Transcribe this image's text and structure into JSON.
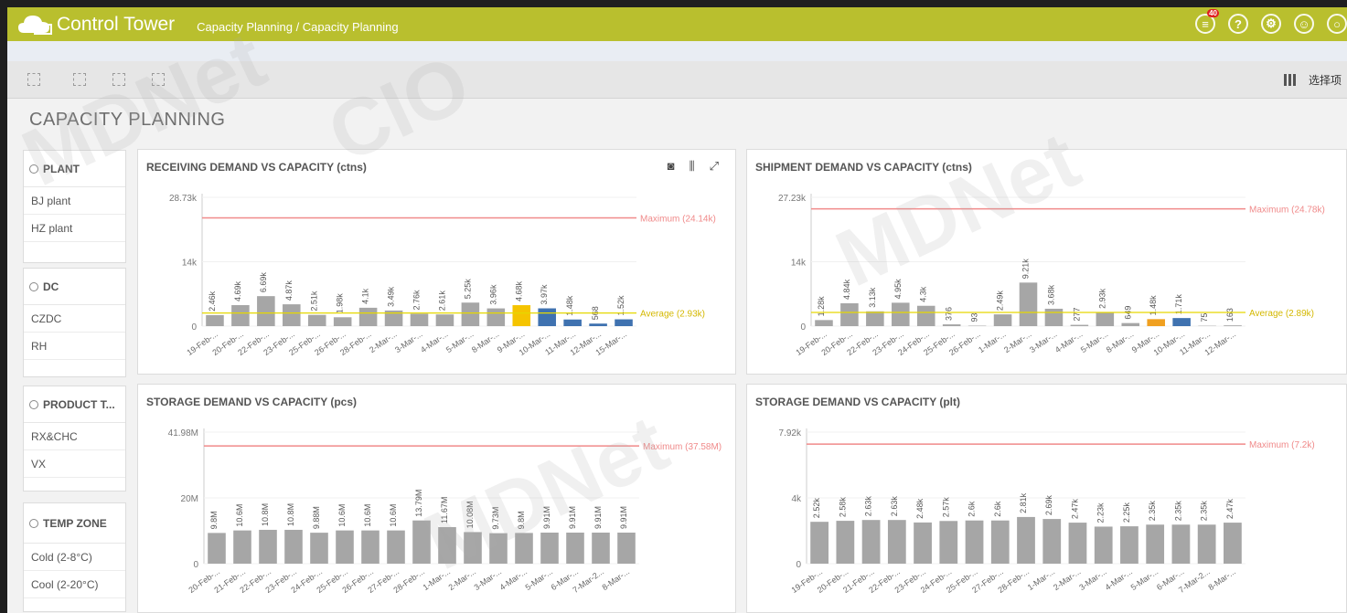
{
  "header": {
    "app_title": "Control Tower",
    "breadcrumb": "Capacity Planning / Capacity Planning",
    "notification_count": "40"
  },
  "toolbar": {
    "selections_label": "选择项"
  },
  "sheet": {
    "title": "CAPACITY PLANNING"
  },
  "filters": [
    {
      "title": "PLANT",
      "items": [
        "BJ plant",
        "HZ plant"
      ]
    },
    {
      "title": "DC",
      "items": [
        "CZDC",
        "RH"
      ]
    },
    {
      "title": "PRODUCT T...",
      "items": [
        "RX&CHC",
        "VX"
      ]
    },
    {
      "title": "TEMP ZONE",
      "items": [
        "Cold (2-8°C)",
        "Cool (2-20°C)"
      ]
    }
  ],
  "colors": {
    "accent": "#b9bf2e",
    "bar": "#a6a6a6",
    "max_line": "#f08a8a",
    "avg_line": "#e6d800",
    "yellow": "#f5c400",
    "blue": "#3f72b0",
    "orange": "#f0a020"
  },
  "chart_data": [
    {
      "type": "bar",
      "title": "RECEIVING DEMAND VS CAPACITY (ctns)",
      "categories": [
        "19-Feb-...",
        "20-Feb-...",
        "22-Feb-...",
        "23-Feb-...",
        "25-Feb-...",
        "26-Feb-...",
        "28-Feb-...",
        "2-Mar-...",
        "3-Mar-...",
        "4-Mar-...",
        "5-Mar-...",
        "8-Mar-...",
        "9-Mar-...",
        "10-Mar-...",
        "11-Mar-...",
        "12-Mar-...",
        "15-Mar-..."
      ],
      "values": [
        2460,
        4690,
        6690,
        4870,
        2510,
        1980,
        4100,
        3490,
        2760,
        2610,
        5250,
        3960,
        4680,
        3970,
        1480,
        568,
        1520
      ],
      "value_labels": [
        "2.46k",
        "4.69k",
        "6.69k",
        "4.87k",
        "2.51k",
        "1.98k",
        "4.1k",
        "3.49k",
        "2.76k",
        "2.61k",
        "5.25k",
        "3.96k",
        "4.68k",
        "3.97k",
        "1.48k",
        "568",
        "1.52k"
      ],
      "bar_colors": [
        "bar",
        "bar",
        "bar",
        "bar",
        "bar",
        "bar",
        "bar",
        "bar",
        "bar",
        "bar",
        "bar",
        "bar",
        "yellow",
        "blue",
        "blue",
        "blue",
        "blue"
      ],
      "y_ticks": [
        "28.73k",
        "14k",
        "0"
      ],
      "ylim": [
        0,
        28730
      ],
      "max_value": 24140,
      "max_label": "Maximum (24.14k)",
      "avg_value": 2930,
      "avg_label": "Average (2.93k)"
    },
    {
      "type": "bar",
      "title": "SHIPMENT DEMAND VS CAPACITY (ctns)",
      "categories": [
        "19-Feb-...",
        "20-Feb-...",
        "22-Feb-...",
        "23-Feb-...",
        "24-Feb-...",
        "25-Feb-...",
        "26-Feb-...",
        "1-Mar-...",
        "2-Mar-...",
        "3-Mar-...",
        "4-Mar-...",
        "5-Mar-...",
        "8-Mar-...",
        "9-Mar-...",
        "10-Mar-...",
        "11-Mar-...",
        "12-Mar-..."
      ],
      "values": [
        1280,
        4840,
        3130,
        4950,
        4300,
        376,
        93,
        2490,
        9210,
        3680,
        277,
        2930,
        649,
        1480,
        1710,
        75,
        163
      ],
      "value_labels": [
        "1.28k",
        "4.84k",
        "3.13k",
        "4.95k",
        "4.3k",
        "376",
        "93",
        "2.49k",
        "9.21k",
        "3.68k",
        "277",
        "2.93k",
        "649",
        "1.48k",
        "1.71k",
        "75",
        "163"
      ],
      "bar_colors": [
        "bar",
        "bar",
        "bar",
        "bar",
        "bar",
        "bar",
        "bar",
        "bar",
        "bar",
        "bar",
        "bar",
        "bar",
        "bar",
        "orange",
        "blue",
        "bar",
        "bar"
      ],
      "y_ticks": [
        "27.23k",
        "14k",
        "0"
      ],
      "ylim": [
        0,
        27230
      ],
      "max_value": 24780,
      "max_label": "Maximum (24.78k)",
      "avg_value": 2890,
      "avg_label": "Average (2.89k)"
    },
    {
      "type": "bar",
      "title": "STORAGE DEMAND VS CAPACITY (pcs)",
      "categories": [
        "20-Feb-...",
        "21-Feb-...",
        "22-Feb-...",
        "23-Feb-...",
        "24-Feb-...",
        "25-Feb-...",
        "26-Feb-...",
        "27-Feb-...",
        "28-Feb-...",
        "1-Mar-...",
        "2-Mar-...",
        "3-Mar-...",
        "4-Mar-...",
        "5-Mar-...",
        "6-Mar-...",
        "7-Mar-2...",
        "8-Mar-..."
      ],
      "values": [
        9800000,
        10600000,
        10800000,
        10800000,
        9880000,
        10600000,
        10600000,
        10600000,
        13790000,
        11670000,
        10080000,
        9730000,
        9800000,
        9910000,
        9910000,
        9910000,
        9910000
      ],
      "value_labels": [
        "9.8M",
        "10.6M",
        "10.8M",
        "10.8M",
        "9.88M",
        "10.6M",
        "10.6M",
        "10.6M",
        "13.79M",
        "11.67M",
        "10.08M",
        "9.73M",
        "9.8M",
        "9.91M",
        "9.91M",
        "9.91M",
        "9.91M"
      ],
      "bar_colors": [
        "bar",
        "bar",
        "bar",
        "bar",
        "bar",
        "bar",
        "bar",
        "bar",
        "bar",
        "bar",
        "bar",
        "bar",
        "bar",
        "bar",
        "bar",
        "bar",
        "bar"
      ],
      "y_ticks": [
        "41.98M",
        "20M",
        "0"
      ],
      "ylim": [
        0,
        41980000
      ],
      "max_value": 37580000,
      "max_label": "Maximum (37.58M)"
    },
    {
      "type": "bar",
      "title": "STORAGE DEMAND VS CAPACITY (plt)",
      "categories": [
        "19-Feb-...",
        "20-Feb-...",
        "21-Feb-...",
        "22-Feb-...",
        "23-Feb-...",
        "24-Feb-...",
        "25-Feb-...",
        "27-Feb-...",
        "28-Feb-...",
        "1-Mar-...",
        "2-Mar-...",
        "3-Mar-...",
        "4-Mar-...",
        "5-Mar-...",
        "6-Mar-...",
        "7-Mar-2...",
        "8-Mar-..."
      ],
      "values": [
        2520,
        2580,
        2630,
        2630,
        2480,
        2570,
        2600,
        2600,
        2810,
        2690,
        2470,
        2230,
        2250,
        2350,
        2350,
        2350,
        2470
      ],
      "value_labels": [
        "2.52k",
        "2.58k",
        "2.63k",
        "2.63k",
        "2.48k",
        "2.57k",
        "2.6k",
        "2.6k",
        "2.81k",
        "2.69k",
        "2.47k",
        "2.23k",
        "2.25k",
        "2.35k",
        "2.35k",
        "2.35k",
        "2.47k"
      ],
      "bar_colors": [
        "bar",
        "bar",
        "bar",
        "bar",
        "bar",
        "bar",
        "bar",
        "bar",
        "bar",
        "bar",
        "bar",
        "bar",
        "bar",
        "bar",
        "bar",
        "bar",
        "bar"
      ],
      "y_ticks": [
        "7.92k",
        "4k",
        "0"
      ],
      "ylim": [
        0,
        7920
      ],
      "max_value": 7200,
      "max_label": "Maximum (7.2k)"
    }
  ]
}
